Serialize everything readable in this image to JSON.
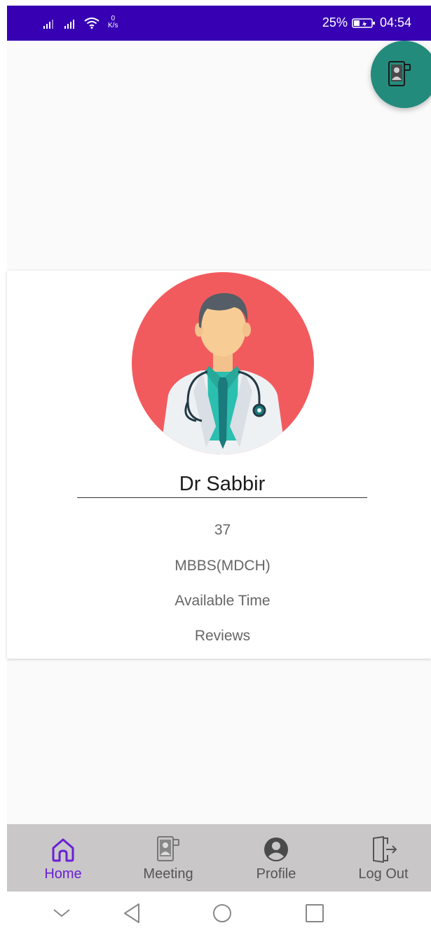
{
  "status_bar": {
    "netspeed_value": "0",
    "netspeed_unit": "K/s",
    "battery": "25%",
    "time": "04:54"
  },
  "doctor": {
    "name": "Dr Sabbir",
    "age": "37",
    "degree": "MBBS(MDCH)",
    "available_time": "Available Time",
    "reviews": "Reviews"
  },
  "bottom_nav": {
    "items": [
      {
        "label": "Home",
        "icon": "home-icon",
        "active": true
      },
      {
        "label": "Meeting",
        "icon": "meeting-icon",
        "active": false
      },
      {
        "label": "Profile",
        "icon": "profile-icon",
        "active": false
      },
      {
        "label": "Log Out",
        "icon": "logout-icon",
        "active": false
      }
    ]
  },
  "colors": {
    "status_bar": "#3700B3",
    "fab": "#238b7c",
    "avatar_bg": "#f25b5e",
    "active_nav": "#6a1fd6",
    "bottom_nav_bg": "#c9c7c7"
  }
}
